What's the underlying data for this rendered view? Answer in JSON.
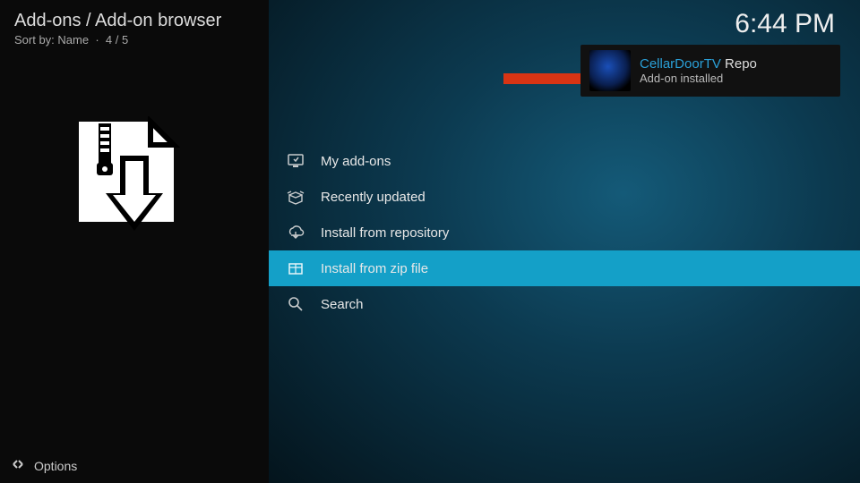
{
  "header": {
    "breadcrumb": "Add-ons / Add-on browser",
    "sort_label": "Sort by: Name",
    "position": "4 / 5"
  },
  "clock": "6:44 PM",
  "menu": {
    "items": [
      {
        "label": "My add-ons",
        "highlighted": false
      },
      {
        "label": "Recently updated",
        "highlighted": false
      },
      {
        "label": "Install from repository",
        "highlighted": false
      },
      {
        "label": "Install from zip file",
        "highlighted": true
      },
      {
        "label": "Search",
        "highlighted": false
      }
    ]
  },
  "notification": {
    "title_brand": "CellarDoorTV",
    "title_rest": " Repo",
    "subtitle": "Add-on installed"
  },
  "footer": {
    "options_label": "Options"
  },
  "colors": {
    "accent": "#14a0c8",
    "link": "#2aa0d8"
  }
}
